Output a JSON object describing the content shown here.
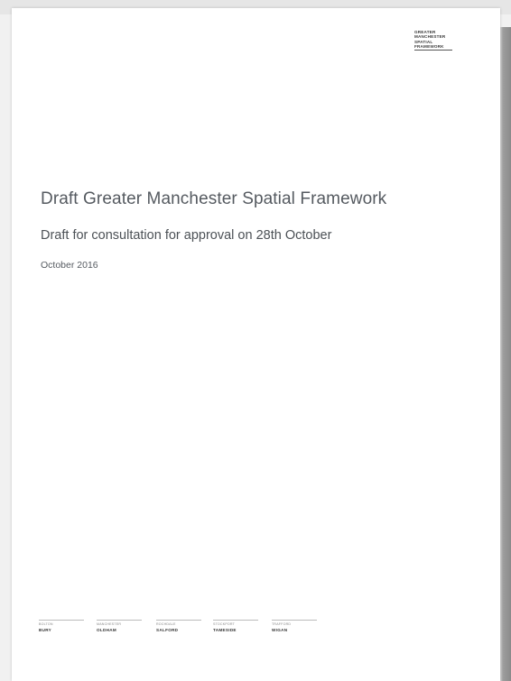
{
  "logo": {
    "lines": [
      "GREATER",
      "MANCHESTER",
      "SPATIAL",
      "FRAMEWORK"
    ]
  },
  "document": {
    "title": "Draft Greater Manchester Spatial Framework",
    "subtitle": "Draft for consultation for approval on 28th October",
    "date": "October 2016"
  },
  "footer": {
    "districts": [
      {
        "small": "BOLTON",
        "name": "BURY"
      },
      {
        "small": "MANCHESTER",
        "name": "OLDHAM"
      },
      {
        "small": "ROCHDALE",
        "name": "SALFORD"
      },
      {
        "small": "STOCKPORT",
        "name": "TAMESIDE"
      },
      {
        "small": "TRAFFORD",
        "name": "WIGAN"
      }
    ]
  },
  "colors": {
    "background": "#f1f1f1",
    "page": "#ffffff",
    "title_text": "#555a60"
  }
}
